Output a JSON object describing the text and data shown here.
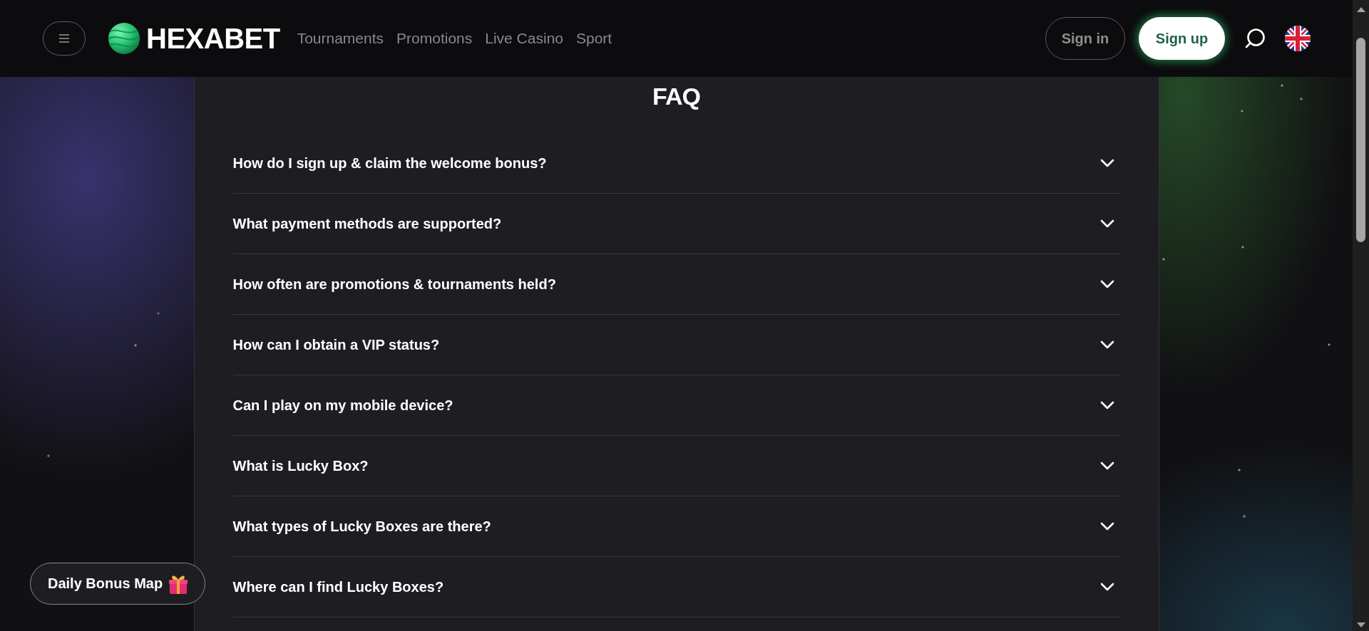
{
  "header": {
    "logo": "HEXABET",
    "nav": [
      "Tournaments",
      "Promotions",
      "Live Casino",
      "Sport"
    ],
    "sign_in": "Sign in",
    "sign_up": "Sign up"
  },
  "faq": {
    "title": "FAQ",
    "items": [
      {
        "question": "How do I sign up & claim the welcome bonus?",
        "expanded": false
      },
      {
        "question": "What payment methods are supported?",
        "expanded": false
      },
      {
        "question": "How often are promotions & tournaments held?",
        "expanded": false
      },
      {
        "question": "How can I obtain a VIP status?",
        "expanded": false
      },
      {
        "question": "Can I play on my mobile device?",
        "expanded": false
      },
      {
        "question": "What is Lucky Box?",
        "expanded": false
      },
      {
        "question": "What types of Lucky Boxes are there?",
        "expanded": false
      },
      {
        "question": "Where can I find Lucky Boxes?",
        "expanded": false
      }
    ]
  },
  "floating_button": {
    "label": "Daily Bonus Map"
  }
}
